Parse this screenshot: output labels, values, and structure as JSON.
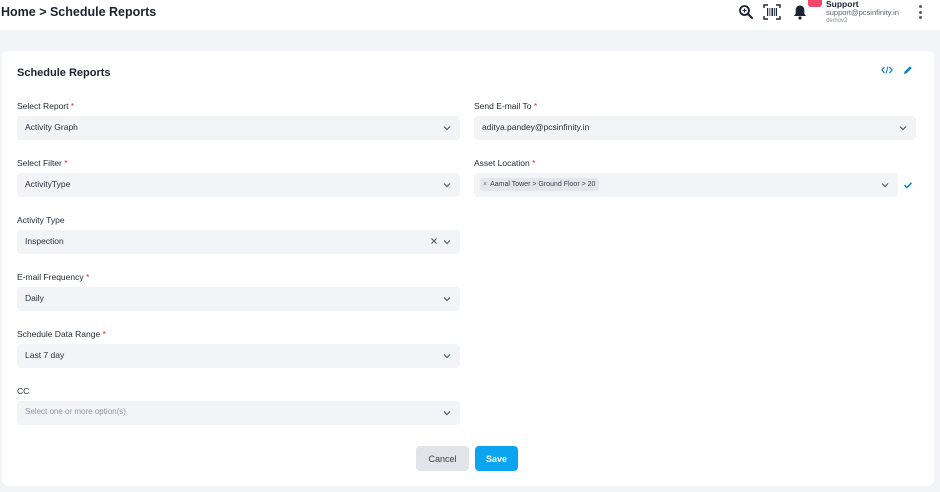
{
  "header": {
    "breadcrumb": "Home > Schedule Reports",
    "user": {
      "name": "Support",
      "email": "support@pcsinfinity.in",
      "role": "demov2"
    }
  },
  "page": {
    "title": "Schedule Reports"
  },
  "form": {
    "select_report": {
      "label": "Select Report",
      "value": "Activity Graph"
    },
    "select_filter": {
      "label": "Select Filter",
      "value": "ActivityType"
    },
    "activity_type": {
      "label": "Activity Type",
      "value": "Inspection"
    },
    "email_frequency": {
      "label": "E-mail Frequency",
      "value": "Daily"
    },
    "schedule_range": {
      "label": "Schedule Data Range",
      "value": "Last 7 day"
    },
    "cc": {
      "label": "CC",
      "placeholder": "Select one or more option(s)"
    },
    "send_email_to": {
      "label": "Send E-mail To",
      "value": "aditya.pandey@pcsinfinity.in"
    },
    "asset_location": {
      "label": "Asset Location",
      "chip": "Aamal Tower > Ground Floor > 20",
      "chip_remove": "×"
    },
    "required_mark": "*",
    "clear_mark": "×"
  },
  "actions": {
    "cancel_label": "Cancel",
    "save_label": "Save"
  },
  "colors": {
    "accent": "#0aa4f0",
    "required": "#e0283f",
    "field_bg": "#f2f4f7"
  },
  "icons": [
    "search-icon",
    "barcode-scan-icon",
    "bell-icon",
    "kebab-menu-icon",
    "code-icon",
    "edit-pencil-icon",
    "chevron-down-icon",
    "check-icon"
  ]
}
